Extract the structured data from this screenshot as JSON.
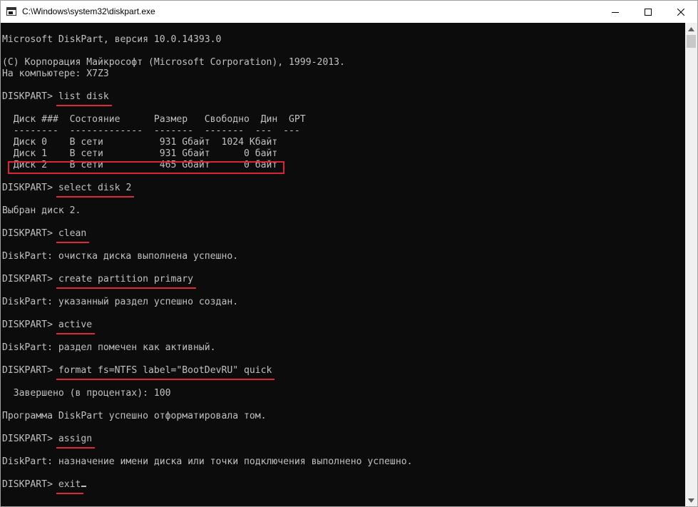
{
  "window": {
    "title": "C:\\Windows\\system32\\diskpart.exe"
  },
  "console": {
    "header": {
      "version": "Microsoft DiskPart, версия 10.0.14393.0",
      "copyright": "(C) Корпорация Майкрософт (Microsoft Corporation), 1999-2013.",
      "computer": "На компьютере: X7Z3"
    },
    "prompt": "DISKPART> ",
    "commands": {
      "list_disk": "list disk",
      "select_disk": "select disk 2",
      "clean": "clean",
      "create_partition": "create partition primary",
      "active": "active",
      "format": "format fs=NTFS label=\"BootDevRU\" quick",
      "assign": "assign",
      "exit": "exit"
    },
    "disk_table": {
      "header": "  Диск ###  Состояние      Размер   Свободно  Дин  GPT",
      "separator": "  --------  -------------  -------  -------  ---  ---",
      "rows": [
        "  Диск 0    В сети          931 Gбайт  1024 Kбайт",
        "  Диск 1    В сети          931 Gбайт      0 байт",
        "  Диск 2    В сети          465 Gбайт      0 байт"
      ]
    },
    "outputs": {
      "selected": "Выбран диск 2.",
      "clean_done": "DiskPart: очистка диска выполнена успешно.",
      "partition_created": "DiskPart: указанный раздел успешно создан.",
      "marked_active": "DiskPart: раздел помечен как активный.",
      "progress": "  Завершено (в процентах): 100",
      "format_done": "Программа DiskPart успешно отформатировала том.",
      "assign_done": "DiskPart: назначение имени диска или точки подключения выполнено успешно."
    }
  },
  "colors": {
    "console_bg": "#0c0c0c",
    "console_text": "#c0c0c0",
    "annotation_red": "#e0293a"
  }
}
